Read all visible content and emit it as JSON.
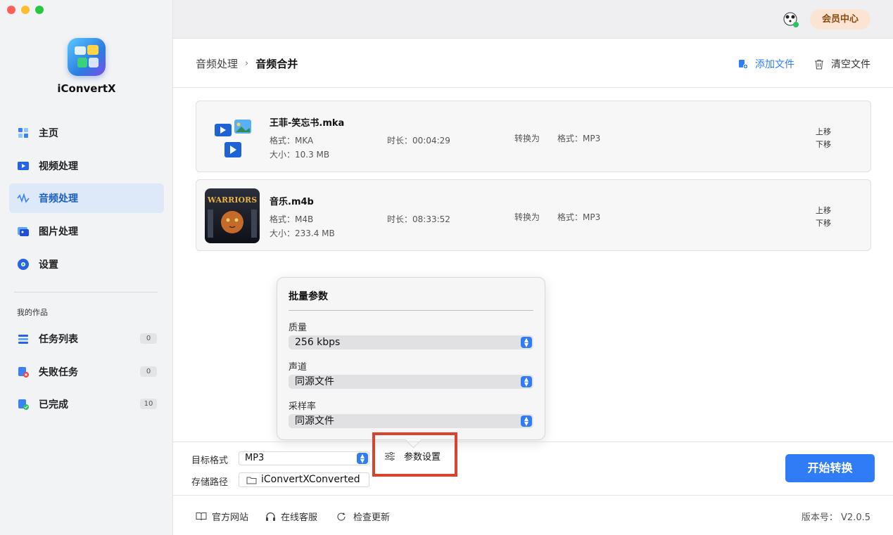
{
  "app": {
    "name": "iConvertX"
  },
  "window": {
    "traffic_colors": [
      "#fe5f57",
      "#febc2e",
      "#28c840"
    ]
  },
  "topbar": {
    "vip_label": "会员中心"
  },
  "sidebar": {
    "items": [
      {
        "label": "主页",
        "icon": "home-icon"
      },
      {
        "label": "视频处理",
        "icon": "video-icon"
      },
      {
        "label": "音频处理",
        "icon": "audio-wave-icon",
        "active": true
      },
      {
        "label": "图片处理",
        "icon": "image-icon"
      },
      {
        "label": "设置",
        "icon": "gear-icon"
      }
    ],
    "section_label": "我的作品",
    "works": [
      {
        "label": "任务列表",
        "count": "0",
        "icon": "task-list-icon"
      },
      {
        "label": "失败任务",
        "count": "0",
        "icon": "failed-task-icon"
      },
      {
        "label": "已完成",
        "count": "10",
        "icon": "completed-icon"
      }
    ]
  },
  "header": {
    "breadcrumb_parent": "音频处理",
    "breadcrumb_sep": "›",
    "breadcrumb_current": "音频合并",
    "add_file_label": "添加文件",
    "clear_files_label": "清空文件",
    "accent": "#2f7cf6"
  },
  "files": [
    {
      "name": "王菲-笑忘书.mka",
      "format": "格式：MKA",
      "size": "大小：10.3 MB",
      "duration": "时长：00:04:29",
      "convert_to": "转换为",
      "target_format": "格式：MP3",
      "move_up": "上移",
      "move_down": "下移"
    },
    {
      "name": "音乐.m4b",
      "format": "格式：M4B",
      "size": "大小：233.4 MB",
      "duration": "时长：08:33:52",
      "convert_to": "转换为",
      "target_format": "格式：MP3",
      "move_up": "上移",
      "move_down": "下移",
      "cover_text": "WARRIORS"
    }
  ],
  "batch_params": {
    "title": "批量参数",
    "quality_label": "质量",
    "quality_value": "256 kbps",
    "channel_label": "声道",
    "channel_value": "同源文件",
    "sample_rate_label": "采样率",
    "sample_rate_value": "同源文件"
  },
  "bottom": {
    "target_format_label": "目标格式",
    "target_format_value": "MP3",
    "save_path_label": "存储路径",
    "save_path_value": "iConvertXConverted",
    "param_settings_label": "参数设置",
    "start_label": "开始转换",
    "highlight_color": "#d8432e"
  },
  "footer": {
    "website": "官方网站",
    "support": "在线客服",
    "update": "检查更新",
    "version": "版本号： V2.0.5"
  }
}
